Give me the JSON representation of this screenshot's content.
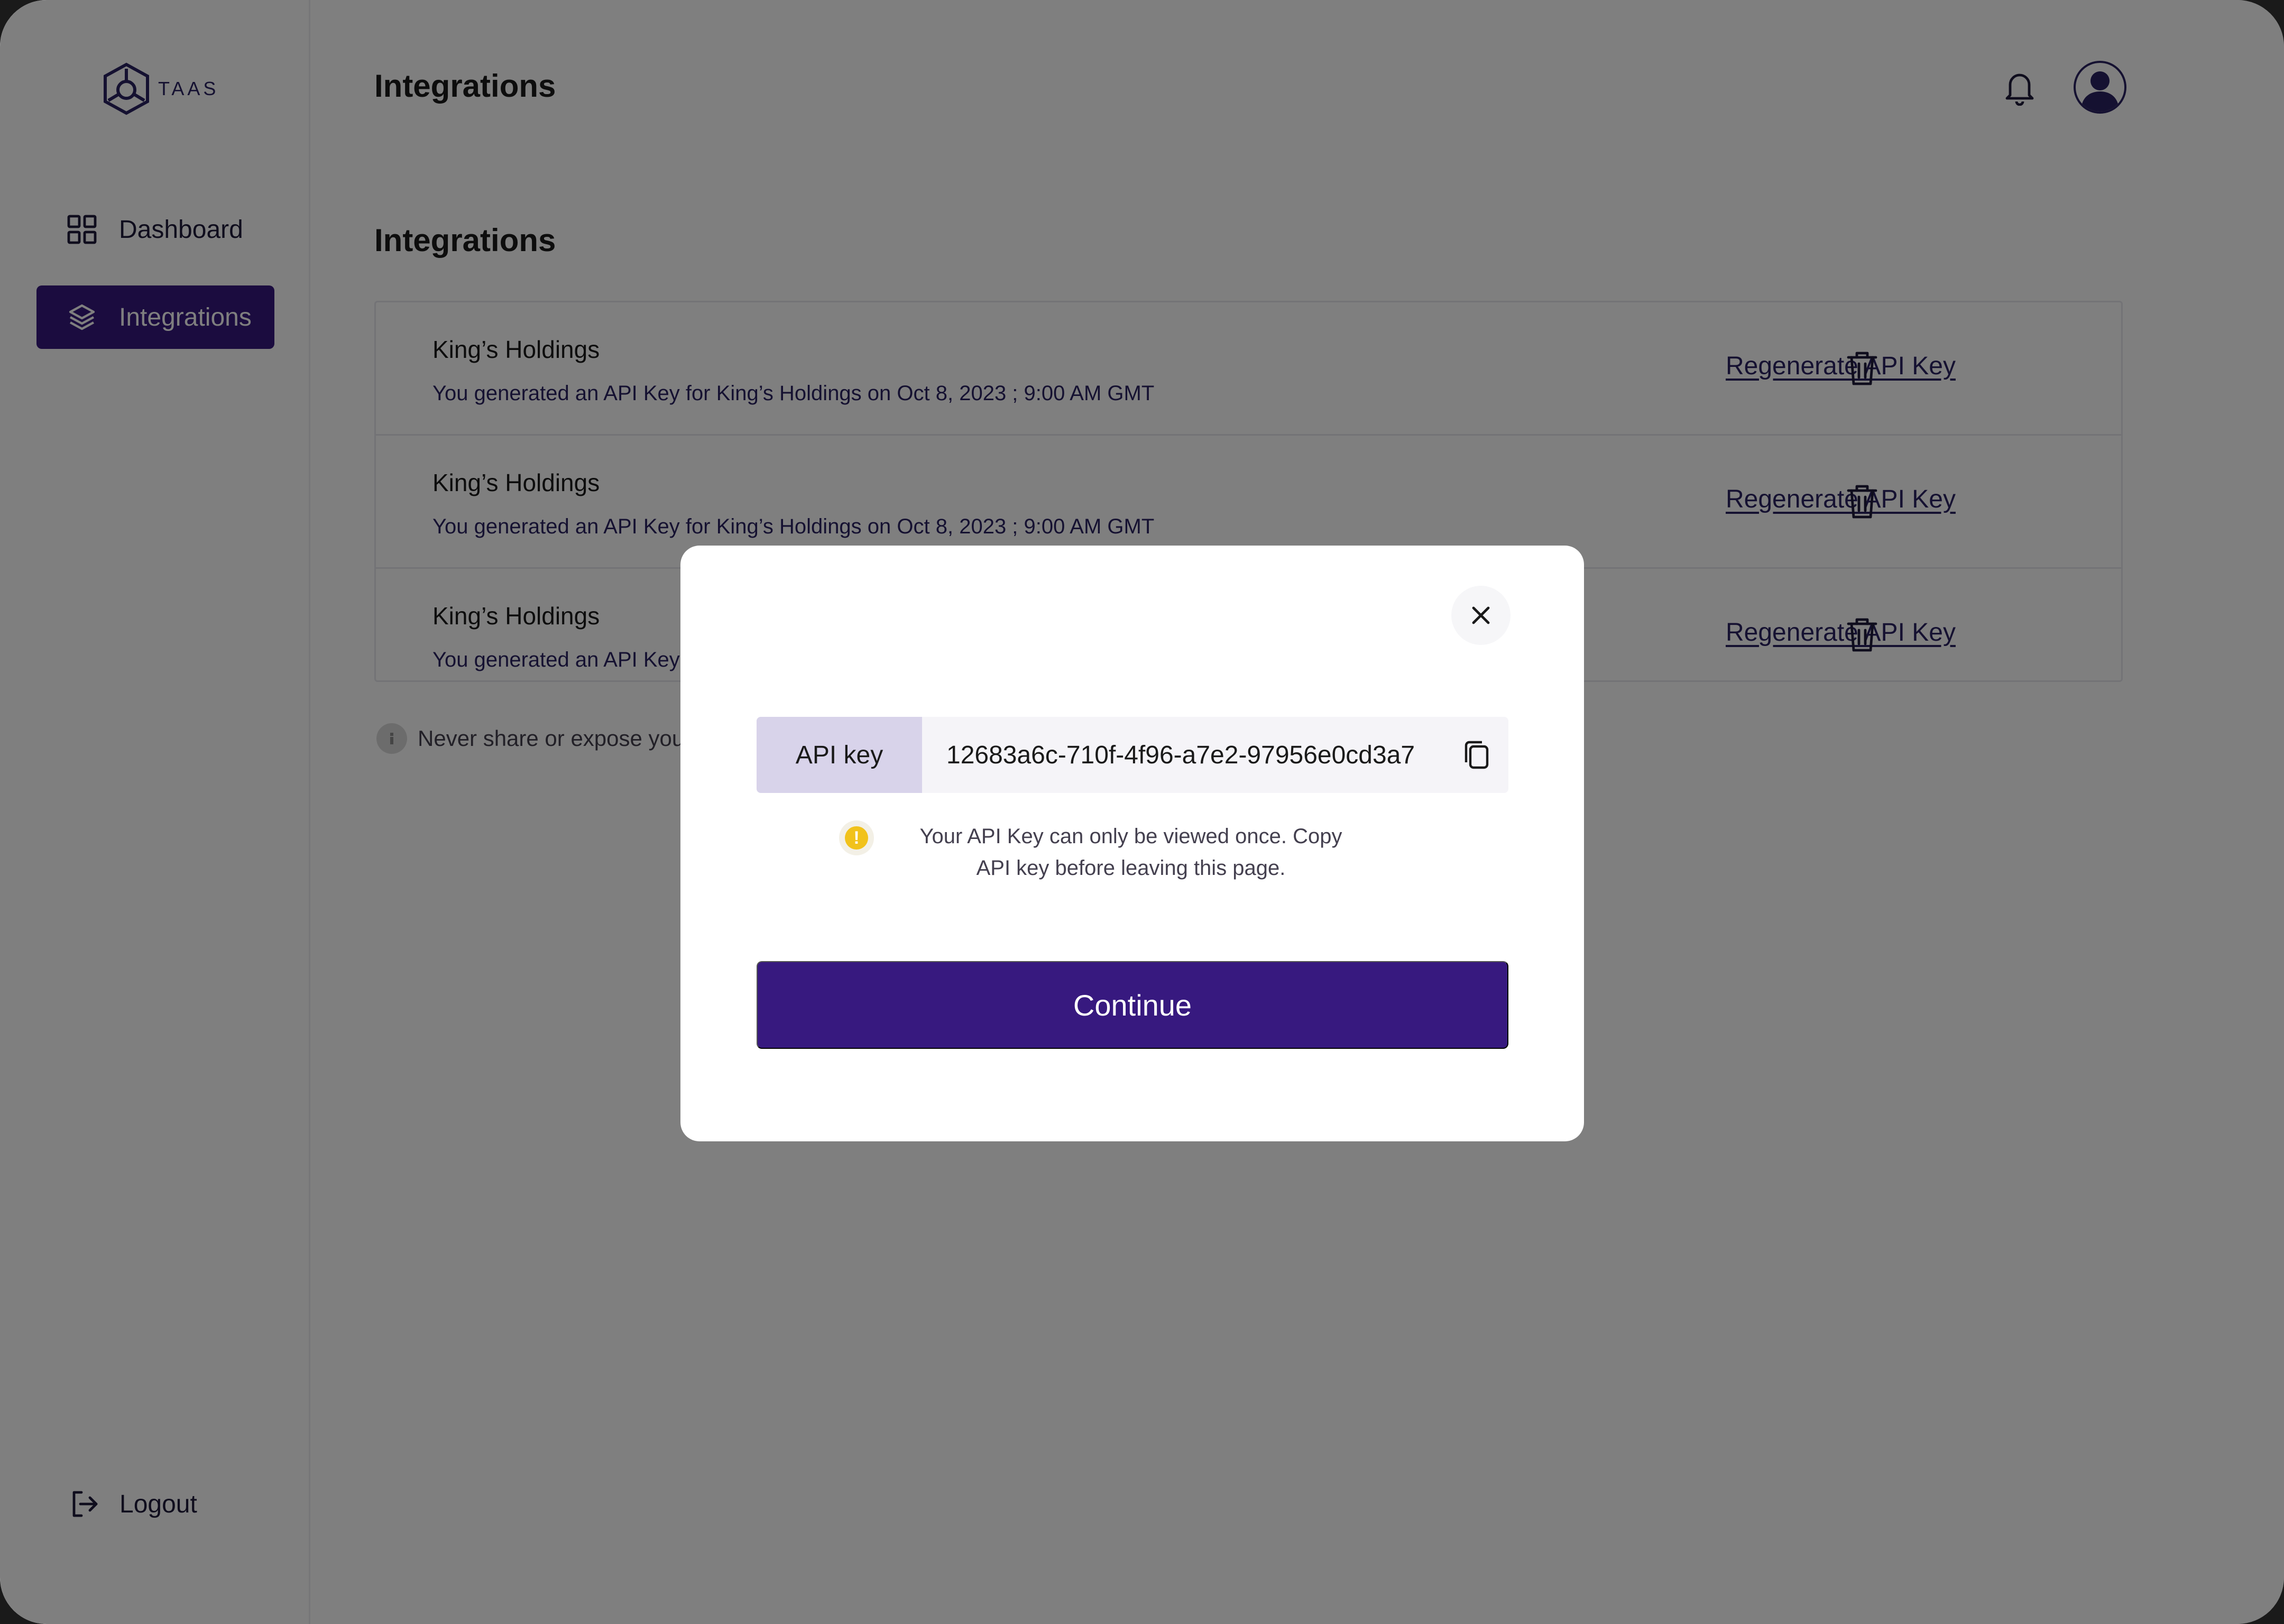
{
  "app": {
    "brand": "TAAS"
  },
  "sidebar": {
    "items": [
      {
        "label": "Dashboard",
        "icon": "grid-icon"
      },
      {
        "label": "Integrations",
        "icon": "layers-icon",
        "active": true
      }
    ],
    "logout_label": "Logout"
  },
  "header": {
    "title": "Integrations"
  },
  "main": {
    "section_title": "Integrations",
    "integrations": [
      {
        "name": "King’s Holdings",
        "description": "You generated an API Key for King’s Holdings on Oct 8, 2023 ; 9:00 AM GMT",
        "action": "Regenerate API Key"
      },
      {
        "name": "King’s Holdings",
        "description": "You generated an API Key for King’s Holdings on Oct 8, 2023 ; 9:00 AM GMT",
        "action": "Regenerate API Key"
      },
      {
        "name": "King’s Holdings",
        "description": "You generated an API Key for King’s Holdings on Oct 8, 2023 ; 9:00 AM GMT",
        "action": "Regenerate API Key"
      }
    ],
    "notice": "Never share or expose your API key"
  },
  "modal": {
    "api_key_label": "API key",
    "api_key_value": "12683a6c-710f-4f96-a7e2-97956e0cd3a7",
    "warning_line1": "Your API Key can only be viewed once. Copy",
    "warning_line2": "API key before leaving this page.",
    "continue_label": "Continue"
  },
  "colors": {
    "primary": "#37197f",
    "accent_light": "#d8d3ea",
    "warning": "#f1c21b"
  }
}
